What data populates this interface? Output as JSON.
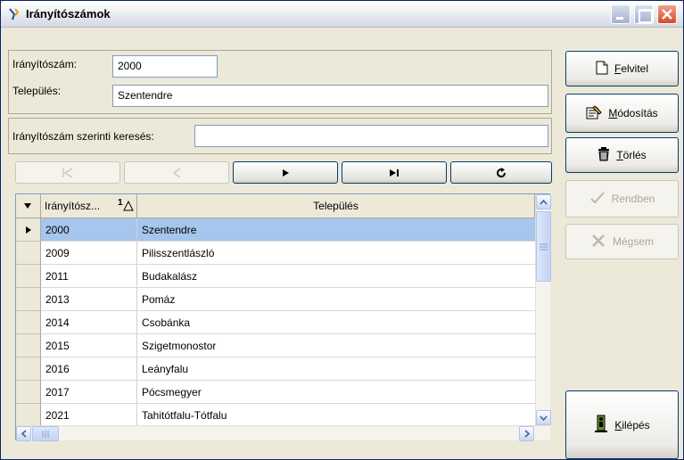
{
  "window": {
    "title": "Irányítószámok"
  },
  "titlebar": {
    "icon": "app-icon",
    "buttons": [
      "minimize-icon",
      "maximize-icon",
      "close-icon"
    ]
  },
  "fields": {
    "zip_label": "Irányítószám:",
    "zip_value": "2000",
    "settlement_label": "Település:",
    "settlement_value": "Szentendre"
  },
  "search": {
    "label": "Irányítószám szerinti keresés:",
    "value": ""
  },
  "navigator": [
    "first",
    "prior",
    "next",
    "last",
    "refresh"
  ],
  "grid": {
    "headers": {
      "zip": "Irányítósz...",
      "sort_indicator": "1",
      "settlement": "Település"
    },
    "rows": [
      {
        "zip": "2000",
        "settlement": "Szentendre"
      },
      {
        "zip": "2009",
        "settlement": "Pilisszentlászló"
      },
      {
        "zip": "2011",
        "settlement": "Budakalász"
      },
      {
        "zip": "2013",
        "settlement": "Pomáz"
      },
      {
        "zip": "2014",
        "settlement": "Csobánka"
      },
      {
        "zip": "2015",
        "settlement": "Szigetmonostor"
      },
      {
        "zip": "2016",
        "settlement": "Leányfalu"
      },
      {
        "zip": "2017",
        "settlement": "Pócsmegyer"
      },
      {
        "zip": "2021",
        "settlement": "Tahitótfalu-Tótfalu"
      }
    ],
    "selected_row": 0
  },
  "side": {
    "new_first": "F",
    "new_rest": "elvitel",
    "edit_first": "M",
    "edit_rest": "ódosítás",
    "delete_first": "T",
    "delete_rest": "örlés",
    "ok": "Rendben",
    "cancel": "Mégsem",
    "exit_first": "K",
    "exit_rest": "ilépés"
  }
}
